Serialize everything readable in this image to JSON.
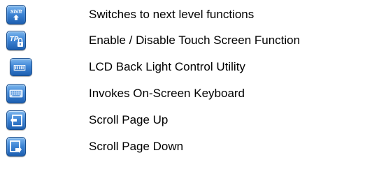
{
  "legend": {
    "items": [
      {
        "icon": "shift-icon",
        "icon_text": "Shift",
        "label": "Switches to next level functions"
      },
      {
        "icon": "touch-panel-lock-icon",
        "icon_text": "TP",
        "label": "Enable / Disable Touch Screen Function"
      },
      {
        "icon": "backlight-icon",
        "label": "LCD Back Light Control Utility"
      },
      {
        "icon": "keyboard-icon",
        "label": "Invokes On-Screen Keyboard"
      },
      {
        "icon": "page-up-icon",
        "label": "Scroll Page Up"
      },
      {
        "icon": "page-down-icon",
        "label": "Scroll Page Down"
      }
    ]
  },
  "colors": {
    "button_top": "#7fb8ee",
    "button_bottom": "#1d5fb0",
    "button_border": "#164c8d",
    "text": "#000000",
    "background": "#ffffff"
  }
}
